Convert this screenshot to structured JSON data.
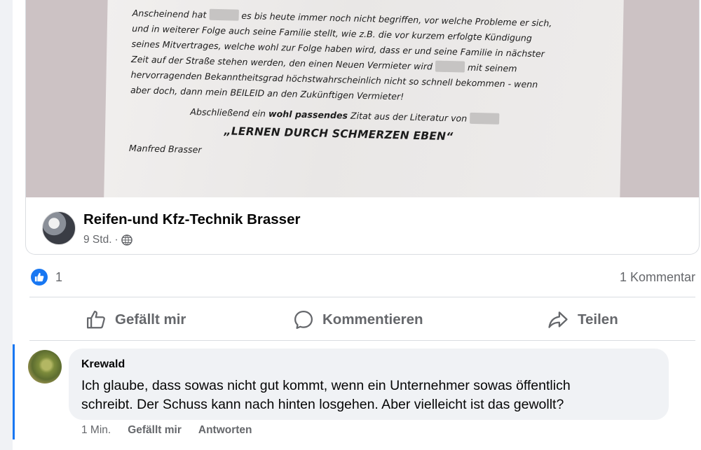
{
  "post_image": {
    "letter_lines": [
      {
        "before": "Anscheinend hat ",
        "blur": true,
        "after": " es bis heute immer noch nicht begriffen, vor welche Probleme er sich,"
      },
      {
        "before": "und in weiterer Folge auch seine Familie stellt, wie z.B. die vor kurzem erfolgte Kündigung",
        "blur": false,
        "after": ""
      },
      {
        "before": "seines Mitvertrages, welche wohl zur Folge haben wird, dass er und seine Familie in nächster",
        "blur": false,
        "after": ""
      },
      {
        "before": "Zeit auf der Straße stehen werden, den einen Neuen Vermieter wird ",
        "blur": true,
        "after": " mit seinem"
      },
      {
        "before": "hervorragenden Bekanntheitsgrad höchstwahrscheinlich nicht so schnell bekommen - wenn",
        "blur": false,
        "after": ""
      },
      {
        "before": "aber doch, dann mein BEILEID an den Zukünftigen Vermieter!",
        "blur": false,
        "after": ""
      }
    ],
    "closing_before": "Abschließend ein ",
    "closing_bold": "wohl passendes",
    "closing_after": " Zitat aus der Literatur von ",
    "quote": "„LERNEN DURCH SCHMERZEN EBEN“",
    "signature": "Manfred Brasser"
  },
  "shared_post": {
    "page_name": "Reifen-und Kfz-Technik Brasser",
    "time": "9 Std.",
    "separator": "·",
    "audience_icon": "globe-icon"
  },
  "reactions": {
    "like_count": "1",
    "comment_count": "1 Kommentar",
    "icon": "thumbs-up-icon"
  },
  "actions": {
    "like_label": "Gefällt mir",
    "comment_label": "Kommentieren",
    "share_label": "Teilen"
  },
  "comment": {
    "author": "Krewald",
    "text_line1": "Ich glaube, dass sowas nicht gut kommt, wenn ein Unternehmer sowas öffentlich",
    "text_line2": "schreibt. Der Schuss kann nach hinten losgehen. Aber vielleicht ist das gewollt?",
    "time": "1 Min.",
    "like_label": "Gefällt mir",
    "reply_label": "Antworten"
  },
  "colors": {
    "accent": "#1877f2",
    "secondary_text": "#65676b",
    "bubble": "#f0f2f5"
  }
}
